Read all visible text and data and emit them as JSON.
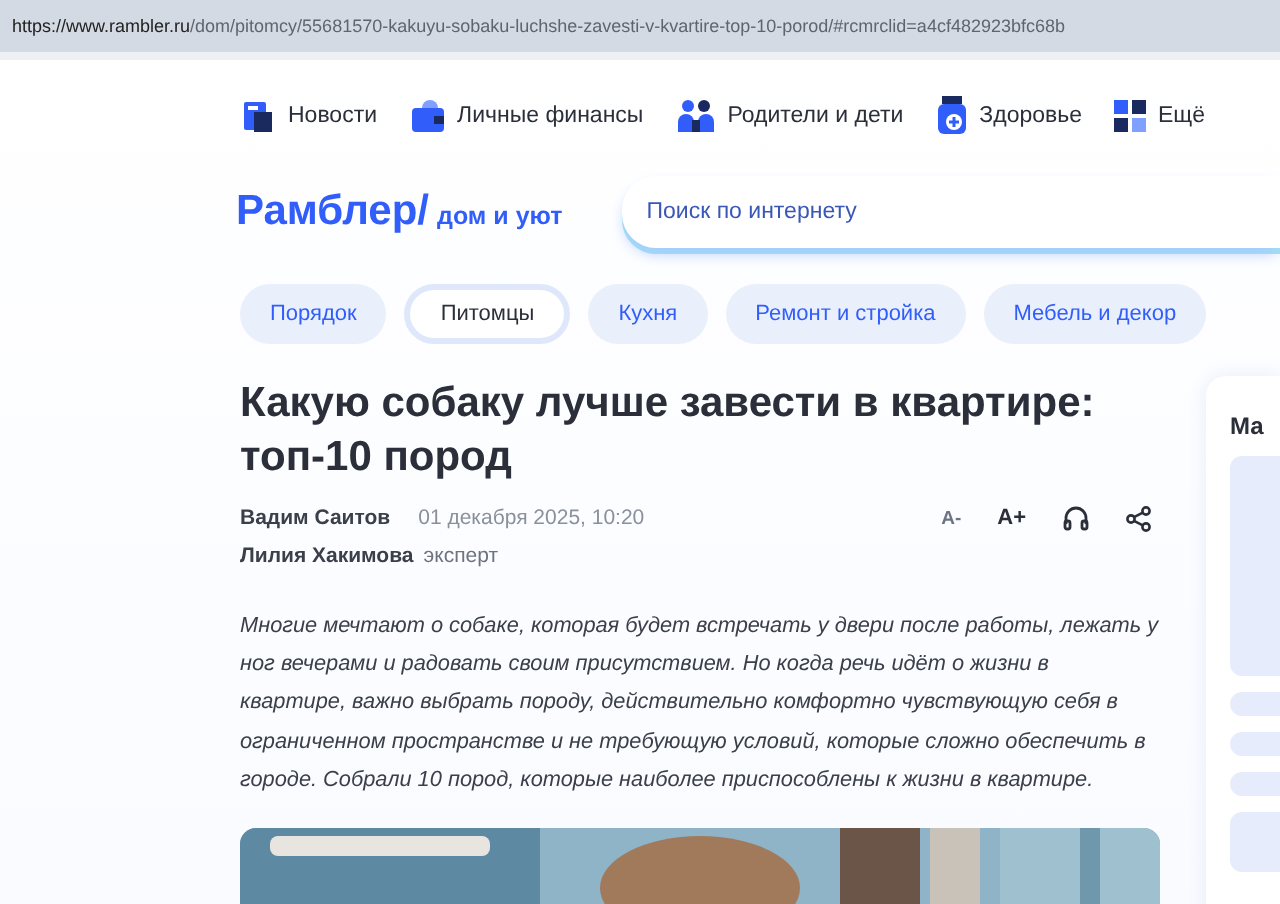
{
  "address_bar": {
    "host": "https://www.rambler.ru",
    "path": "/dom/pitomcy/55681570-kakuyu-sobaku-luchshe-zavesti-v-kvartire-top-10-porod/#rcmrclid=a4cf482923bfc68b"
  },
  "top_nav": [
    {
      "kind": "news",
      "label": "Новости"
    },
    {
      "kind": "finance",
      "label": "Личные финансы"
    },
    {
      "kind": "family",
      "label": "Родители и дети"
    },
    {
      "kind": "health",
      "label": "Здоровье"
    },
    {
      "kind": "more",
      "label": "Ещё"
    }
  ],
  "logo": {
    "brand": "Рамблер/",
    "section": "дом и уют"
  },
  "search": {
    "placeholder": "Поиск по интернету"
  },
  "tabs": [
    {
      "label": "Порядок",
      "selected": false
    },
    {
      "label": "Питомцы",
      "selected": true
    },
    {
      "label": "Кухня",
      "selected": false
    },
    {
      "label": "Ремонт и стройка",
      "selected": false
    },
    {
      "label": "Мебель и декор",
      "selected": false
    }
  ],
  "article": {
    "title": "Какую собаку лучше завести в квартире: топ-10 пород",
    "author": "Вадим Саитов",
    "date": "01 декабря 2025, 10:20",
    "expert": "Лилия Хакимова",
    "expert_role": "эксперт",
    "tools": [
      {
        "kind": "smaller",
        "label": "A-"
      },
      {
        "kind": "larger",
        "label": "A+"
      },
      {
        "kind": "listen"
      },
      {
        "kind": "share"
      }
    ],
    "lead": "Многие мечтают о собаке, которая будет встречать у двери после работы, лежать у ног вечерами и радовать своим присутствием. Но когда речь идёт о жизни в квартире, важно выбрать породу, действительно комфортно чувствующую себя в ограниченном пространстве и не требующую условий, которые сложно обеспечить в городе. Собрали 10 пород, которые наиболее приспособлены к жизни в квартире."
  },
  "sidebar": {
    "title": "Ма"
  }
}
